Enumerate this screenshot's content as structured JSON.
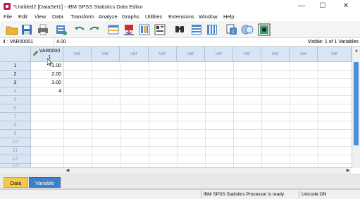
{
  "window": {
    "title": "*Untitled2 [DataSet1] - IBM SPSS Statistics Data Editor",
    "minimize": "—",
    "maximize": "☐",
    "close": "✕"
  },
  "menu": [
    "File",
    "Edit",
    "View",
    "Data",
    "Transform",
    "Analyze",
    "Graphs",
    "Utilities",
    "Extensions",
    "Window",
    "Help"
  ],
  "toolbar": {
    "icons": [
      "open-folder-icon",
      "save-icon",
      "print-icon",
      "recall-dialog-icon",
      "undo-icon",
      "redo-icon",
      "goto-case-icon",
      "goto-variable-icon",
      "variables-icon",
      "run-descriptives-icon",
      "find-icon",
      "insert-cases-icon",
      "insert-variable-icon",
      "split-file-icon",
      "weight-cases-icon",
      "select-cases-icon",
      "value-labels-icon",
      "use-sets-icon",
      "spelling-icon"
    ]
  },
  "cellbar": {
    "reference": "4 : VAR00001",
    "value": "4.00",
    "visible": "Visible: 1 of 1 Variables"
  },
  "grid": {
    "columns": [
      "VAR0000 1",
      "var",
      "var",
      "var",
      "var",
      "var",
      "var",
      "var",
      "var",
      "var",
      "var"
    ],
    "rows": [
      "1",
      "2",
      "3",
      "4",
      "5",
      "6",
      "7",
      "8",
      "9",
      "10",
      "11",
      "12",
      "13"
    ],
    "values": [
      "1.00",
      "2.00",
      "3.00",
      "4"
    ]
  },
  "tabs": {
    "data_view": "Data View",
    "variable_view": "Variable View"
  },
  "status": {
    "processor": "IBM SPSS Statistics Processor is ready",
    "unicode": "Unicode:ON"
  },
  "colors": {
    "header_bg": "#d9e5f3",
    "data_view_tab": "#f2c94c",
    "variable_view_tab": "#3e7fc8",
    "scroll_thumb": "#4d8fd6"
  }
}
